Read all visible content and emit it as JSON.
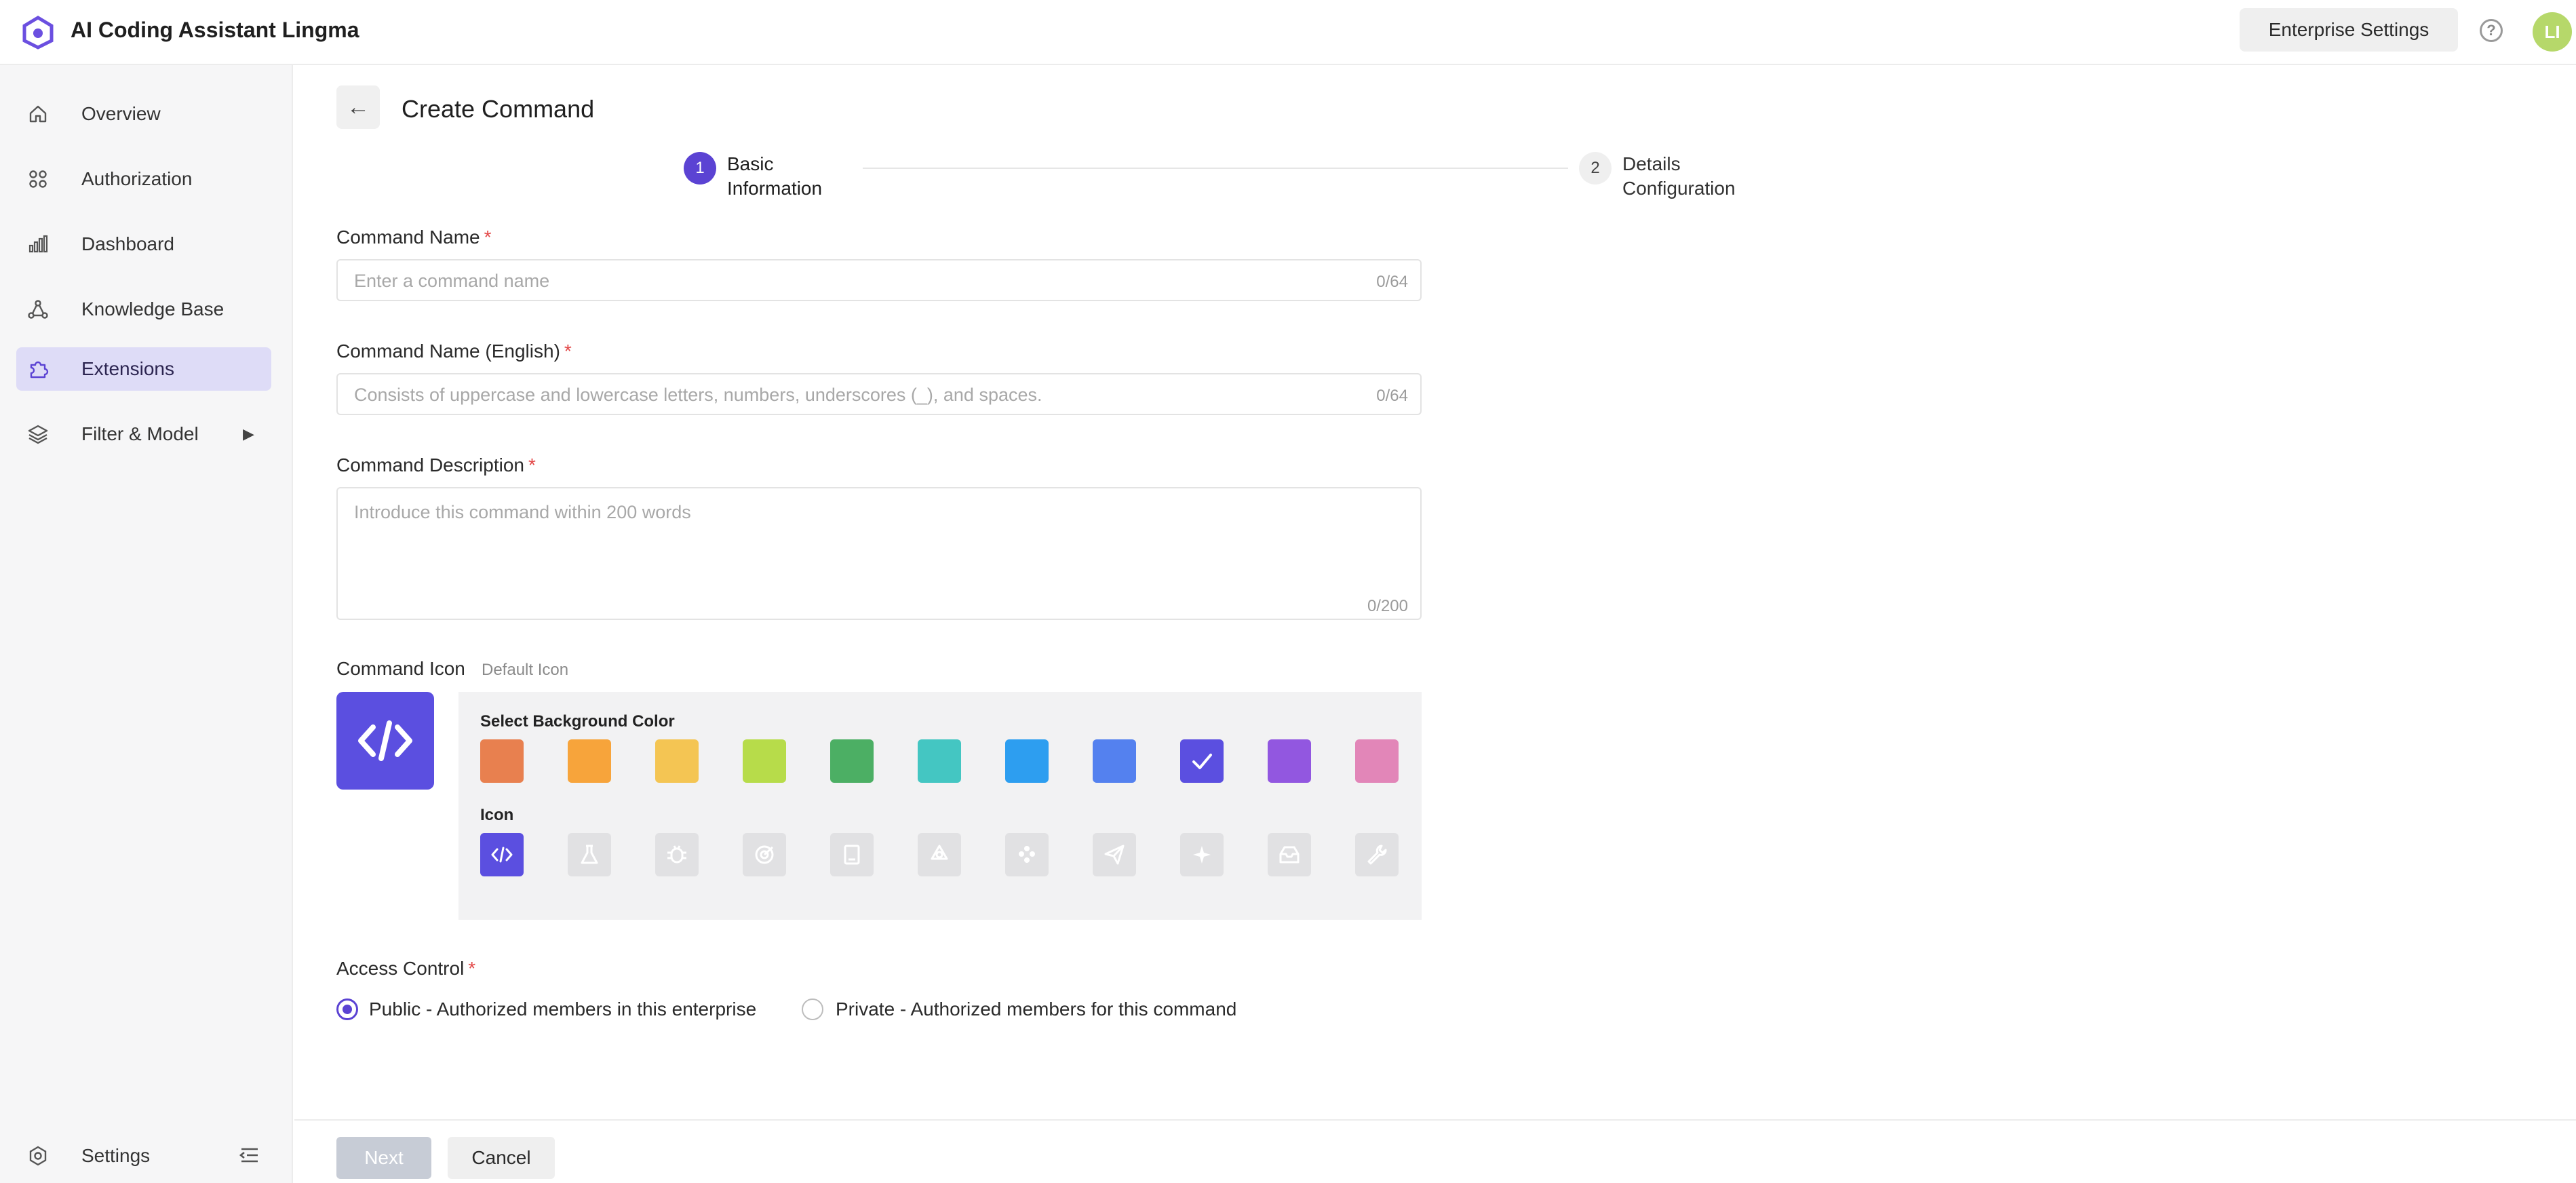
{
  "app": {
    "title": "AI Coding Assistant Lingma",
    "enterprise_settings_label": "Enterprise Settings",
    "help_icon": "question-circle-icon",
    "avatar_initials": "LI",
    "brand_color": "#5b43d3"
  },
  "sidebar": {
    "items": [
      {
        "label": "Overview",
        "icon": "home-icon"
      },
      {
        "label": "Authorization",
        "icon": "grid-icon"
      },
      {
        "label": "Dashboard",
        "icon": "bar-chart-icon"
      },
      {
        "label": "Knowledge Base",
        "icon": "nodes-icon"
      },
      {
        "label": "Extensions",
        "icon": "puzzle-icon",
        "active": true
      },
      {
        "label": "Filter & Model",
        "icon": "layers-icon",
        "expandable": true
      }
    ],
    "settings_label": "Settings",
    "collapse_icon": "collapse-menu-icon"
  },
  "page": {
    "title": "Create Command",
    "back_icon": "arrow-left-icon"
  },
  "steps": [
    {
      "number": "1",
      "label": "Basic Information",
      "active": true
    },
    {
      "number": "2",
      "label": "Details Configuration",
      "active": false
    }
  ],
  "form": {
    "command_name": {
      "label": "Command Name",
      "required_mark": "*",
      "placeholder": "Enter a command name",
      "value": "",
      "counter": "0/64"
    },
    "command_name_en": {
      "label": "Command Name (English)",
      "required_mark": "*",
      "placeholder": "Consists of uppercase and lowercase letters, numbers, underscores (_), and spaces.",
      "value": "",
      "counter": "0/64"
    },
    "command_description": {
      "label": "Command Description",
      "required_mark": "*",
      "placeholder": "Introduce this command within 200 words",
      "value": "",
      "counter": "0/200"
    },
    "command_icon": {
      "label": "Command Icon",
      "hint": "Default Icon",
      "background_title": "Select Background Color",
      "icon_title": "Icon",
      "colors": [
        "#e8804f",
        "#f7a43b",
        "#f4c553",
        "#b7dc4a",
        "#4caf64",
        "#44c6c2",
        "#2d9ef0",
        "#5481ef",
        "#5b4fe0",
        "#9257e0",
        "#e286b8"
      ],
      "selected_color_index": 8,
      "icons": [
        "code-icon",
        "flask-icon",
        "bug-icon",
        "target-icon",
        "book-icon",
        "recycle-icon",
        "flower-icon",
        "paper-plane-icon",
        "sparkle-icon",
        "inbox-icon",
        "wrench-icon"
      ],
      "selected_icon_index": 0
    },
    "access_control": {
      "label": "Access Control",
      "required_mark": "*",
      "options": [
        {
          "label": "Public - Authorized members in this enterprise",
          "checked": true
        },
        {
          "label": "Private - Authorized members for this command",
          "checked": false
        }
      ]
    }
  },
  "footer": {
    "next_label": "Next",
    "cancel_label": "Cancel"
  }
}
